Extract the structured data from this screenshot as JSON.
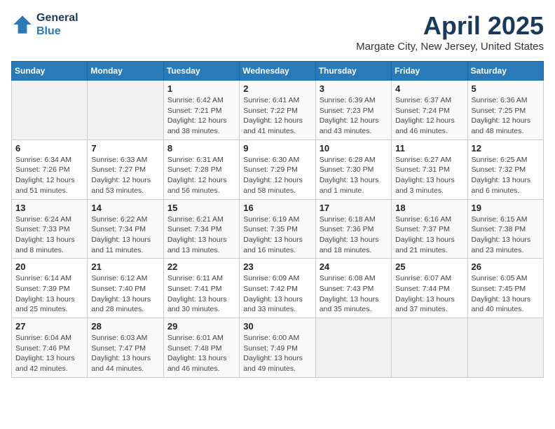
{
  "header": {
    "title": "April 2025",
    "subtitle": "Margate City, New Jersey, United States",
    "logo_line1": "General",
    "logo_line2": "Blue"
  },
  "weekdays": [
    "Sunday",
    "Monday",
    "Tuesday",
    "Wednesday",
    "Thursday",
    "Friday",
    "Saturday"
  ],
  "weeks": [
    [
      {
        "day": null
      },
      {
        "day": null
      },
      {
        "day": "1",
        "sunrise": "Sunrise: 6:42 AM",
        "sunset": "Sunset: 7:21 PM",
        "daylight": "Daylight: 12 hours and 38 minutes."
      },
      {
        "day": "2",
        "sunrise": "Sunrise: 6:41 AM",
        "sunset": "Sunset: 7:22 PM",
        "daylight": "Daylight: 12 hours and 41 minutes."
      },
      {
        "day": "3",
        "sunrise": "Sunrise: 6:39 AM",
        "sunset": "Sunset: 7:23 PM",
        "daylight": "Daylight: 12 hours and 43 minutes."
      },
      {
        "day": "4",
        "sunrise": "Sunrise: 6:37 AM",
        "sunset": "Sunset: 7:24 PM",
        "daylight": "Daylight: 12 hours and 46 minutes."
      },
      {
        "day": "5",
        "sunrise": "Sunrise: 6:36 AM",
        "sunset": "Sunset: 7:25 PM",
        "daylight": "Daylight: 12 hours and 48 minutes."
      }
    ],
    [
      {
        "day": "6",
        "sunrise": "Sunrise: 6:34 AM",
        "sunset": "Sunset: 7:26 PM",
        "daylight": "Daylight: 12 hours and 51 minutes."
      },
      {
        "day": "7",
        "sunrise": "Sunrise: 6:33 AM",
        "sunset": "Sunset: 7:27 PM",
        "daylight": "Daylight: 12 hours and 53 minutes."
      },
      {
        "day": "8",
        "sunrise": "Sunrise: 6:31 AM",
        "sunset": "Sunset: 7:28 PM",
        "daylight": "Daylight: 12 hours and 56 minutes."
      },
      {
        "day": "9",
        "sunrise": "Sunrise: 6:30 AM",
        "sunset": "Sunset: 7:29 PM",
        "daylight": "Daylight: 12 hours and 58 minutes."
      },
      {
        "day": "10",
        "sunrise": "Sunrise: 6:28 AM",
        "sunset": "Sunset: 7:30 PM",
        "daylight": "Daylight: 13 hours and 1 minute."
      },
      {
        "day": "11",
        "sunrise": "Sunrise: 6:27 AM",
        "sunset": "Sunset: 7:31 PM",
        "daylight": "Daylight: 13 hours and 3 minutes."
      },
      {
        "day": "12",
        "sunrise": "Sunrise: 6:25 AM",
        "sunset": "Sunset: 7:32 PM",
        "daylight": "Daylight: 13 hours and 6 minutes."
      }
    ],
    [
      {
        "day": "13",
        "sunrise": "Sunrise: 6:24 AM",
        "sunset": "Sunset: 7:33 PM",
        "daylight": "Daylight: 13 hours and 8 minutes."
      },
      {
        "day": "14",
        "sunrise": "Sunrise: 6:22 AM",
        "sunset": "Sunset: 7:34 PM",
        "daylight": "Daylight: 13 hours and 11 minutes."
      },
      {
        "day": "15",
        "sunrise": "Sunrise: 6:21 AM",
        "sunset": "Sunset: 7:34 PM",
        "daylight": "Daylight: 13 hours and 13 minutes."
      },
      {
        "day": "16",
        "sunrise": "Sunrise: 6:19 AM",
        "sunset": "Sunset: 7:35 PM",
        "daylight": "Daylight: 13 hours and 16 minutes."
      },
      {
        "day": "17",
        "sunrise": "Sunrise: 6:18 AM",
        "sunset": "Sunset: 7:36 PM",
        "daylight": "Daylight: 13 hours and 18 minutes."
      },
      {
        "day": "18",
        "sunrise": "Sunrise: 6:16 AM",
        "sunset": "Sunset: 7:37 PM",
        "daylight": "Daylight: 13 hours and 21 minutes."
      },
      {
        "day": "19",
        "sunrise": "Sunrise: 6:15 AM",
        "sunset": "Sunset: 7:38 PM",
        "daylight": "Daylight: 13 hours and 23 minutes."
      }
    ],
    [
      {
        "day": "20",
        "sunrise": "Sunrise: 6:14 AM",
        "sunset": "Sunset: 7:39 PM",
        "daylight": "Daylight: 13 hours and 25 minutes."
      },
      {
        "day": "21",
        "sunrise": "Sunrise: 6:12 AM",
        "sunset": "Sunset: 7:40 PM",
        "daylight": "Daylight: 13 hours and 28 minutes."
      },
      {
        "day": "22",
        "sunrise": "Sunrise: 6:11 AM",
        "sunset": "Sunset: 7:41 PM",
        "daylight": "Daylight: 13 hours and 30 minutes."
      },
      {
        "day": "23",
        "sunrise": "Sunrise: 6:09 AM",
        "sunset": "Sunset: 7:42 PM",
        "daylight": "Daylight: 13 hours and 33 minutes."
      },
      {
        "day": "24",
        "sunrise": "Sunrise: 6:08 AM",
        "sunset": "Sunset: 7:43 PM",
        "daylight": "Daylight: 13 hours and 35 minutes."
      },
      {
        "day": "25",
        "sunrise": "Sunrise: 6:07 AM",
        "sunset": "Sunset: 7:44 PM",
        "daylight": "Daylight: 13 hours and 37 minutes."
      },
      {
        "day": "26",
        "sunrise": "Sunrise: 6:05 AM",
        "sunset": "Sunset: 7:45 PM",
        "daylight": "Daylight: 13 hours and 40 minutes."
      }
    ],
    [
      {
        "day": "27",
        "sunrise": "Sunrise: 6:04 AM",
        "sunset": "Sunset: 7:46 PM",
        "daylight": "Daylight: 13 hours and 42 minutes."
      },
      {
        "day": "28",
        "sunrise": "Sunrise: 6:03 AM",
        "sunset": "Sunset: 7:47 PM",
        "daylight": "Daylight: 13 hours and 44 minutes."
      },
      {
        "day": "29",
        "sunrise": "Sunrise: 6:01 AM",
        "sunset": "Sunset: 7:48 PM",
        "daylight": "Daylight: 13 hours and 46 minutes."
      },
      {
        "day": "30",
        "sunrise": "Sunrise: 6:00 AM",
        "sunset": "Sunset: 7:49 PM",
        "daylight": "Daylight: 13 hours and 49 minutes."
      },
      {
        "day": null
      },
      {
        "day": null
      },
      {
        "day": null
      }
    ]
  ]
}
